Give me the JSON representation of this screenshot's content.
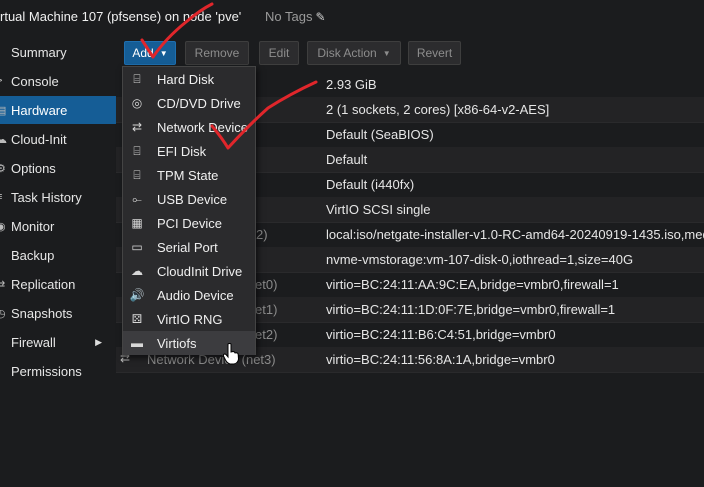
{
  "header": {
    "title": "rtual Machine 107 (pfsense) on node 'pve'",
    "tags": "No Tags"
  },
  "sidebar": {
    "items": [
      {
        "label": "Summary",
        "icon": "summary-icon"
      },
      {
        "label": "Console",
        "icon": "console-icon"
      },
      {
        "label": "Hardware",
        "icon": "hardware-icon"
      },
      {
        "label": "Cloud-Init",
        "icon": "cloud-icon"
      },
      {
        "label": "Options",
        "icon": "gear-icon"
      },
      {
        "label": "Task History",
        "icon": "list-icon"
      },
      {
        "label": "Monitor",
        "icon": "eye-icon"
      },
      {
        "label": "Backup",
        "icon": "floppy-icon"
      },
      {
        "label": "Replication",
        "icon": "retweet-icon"
      },
      {
        "label": "Snapshots",
        "icon": "history-icon"
      },
      {
        "label": "Firewall",
        "icon": "shield-icon"
      },
      {
        "label": "Permissions",
        "icon": "unlock-icon"
      }
    ],
    "active": "Hardware"
  },
  "toolbar": {
    "add": "Add",
    "remove": "Remove",
    "edit": "Edit",
    "disk_action": "Disk Action",
    "revert": "Revert"
  },
  "grid": {
    "rows": [
      {
        "key": "",
        "value": "2.93 GiB"
      },
      {
        "key": "",
        "value": "2 (1 sockets, 2 cores) [x86-64-v2-AES]"
      },
      {
        "key": "",
        "value": "Default (SeaBIOS)"
      },
      {
        "key": "",
        "value": "Default"
      },
      {
        "key": "",
        "value": "Default (i440fx)"
      },
      {
        "key": "",
        "value": "VirtIO SCSI single"
      },
      {
        "key": "2)",
        "value": "local:iso/netgate-installer-v1.0-RC-amd64-20240919-1435.iso,med"
      },
      {
        "key": "",
        "value": "nvme-vmstorage:vm-107-disk-0,iothread=1,size=40G"
      },
      {
        "key": "et0)",
        "value": "virtio=BC:24:11:AA:9C:EA,bridge=vmbr0,firewall=1"
      },
      {
        "key": "et1)",
        "value": "virtio=BC:24:11:1D:0F:7E,bridge=vmbr0,firewall=1"
      },
      {
        "key": "et2)",
        "value": "virtio=BC:24:11:B6:C4:51,bridge=vmbr0"
      },
      {
        "key": "Network Device (net3)",
        "value": "virtio=BC:24:11:56:8A:1A,bridge=vmbr0"
      }
    ]
  },
  "menu": {
    "items": [
      {
        "label": "Hard Disk",
        "icon": "hdd-icon"
      },
      {
        "label": "CD/DVD Drive",
        "icon": "cdrom-icon"
      },
      {
        "label": "Network Device",
        "icon": "exchange-icon"
      },
      {
        "label": "EFI Disk",
        "icon": "hdd-icon"
      },
      {
        "label": "TPM State",
        "icon": "hdd-icon"
      },
      {
        "label": "USB Device",
        "icon": "usb-icon"
      },
      {
        "label": "PCI Device",
        "icon": "pci-card-icon"
      },
      {
        "label": "Serial Port",
        "icon": "serial-port-icon"
      },
      {
        "label": "CloudInit Drive",
        "icon": "cloud-icon"
      },
      {
        "label": "Audio Device",
        "icon": "volume-icon"
      },
      {
        "label": "VirtIO RNG",
        "icon": "dice-icon"
      },
      {
        "label": "Virtiofs",
        "icon": "folder-icon"
      }
    ],
    "hovered": "Virtiofs"
  },
  "colors": {
    "accent": "#155d96",
    "annotation": "#e0262b",
    "background": "#1b1c1e"
  }
}
